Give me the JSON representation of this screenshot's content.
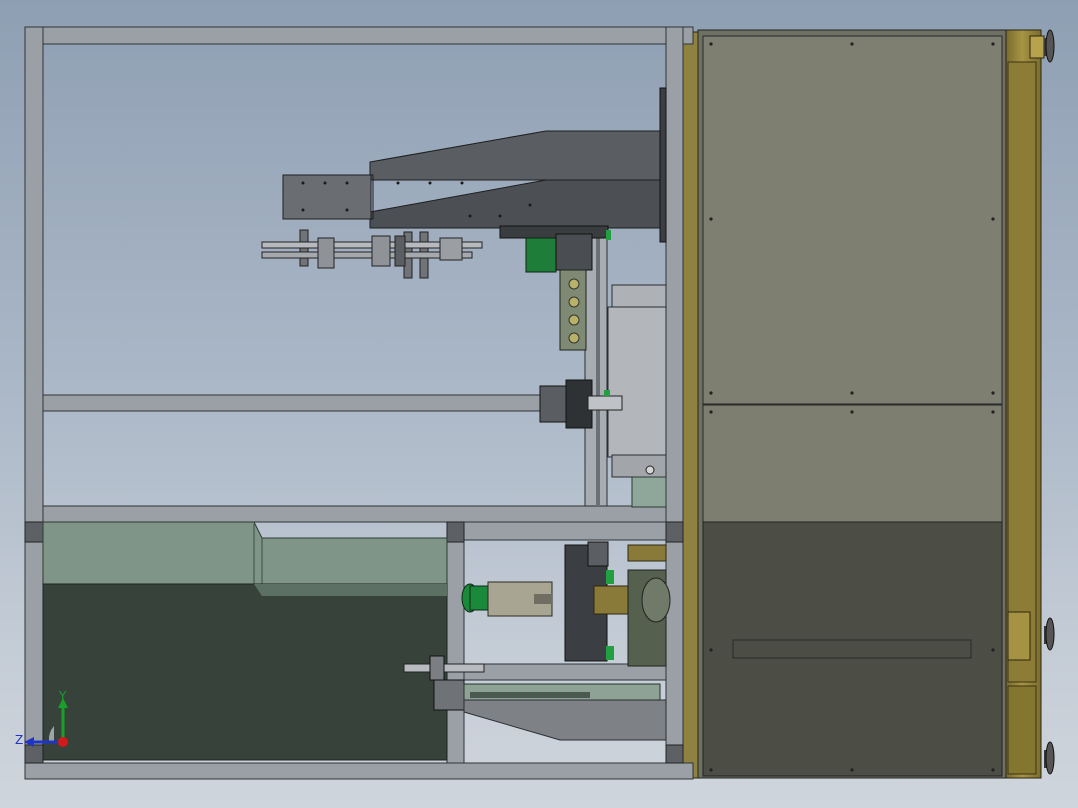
{
  "viewport": {
    "colors": {
      "frame": "#9aa0a6",
      "panel": "#7f8173",
      "panel_lower": "#4d5047",
      "guard_green": "#7e9589",
      "guard_dark": "#36423b",
      "base_gold": "#8a7a3a",
      "dark_steel": "#4b4e52",
      "accent_green": "#1a8a3a"
    }
  },
  "triad": {
    "y_label": "Y",
    "z_label": "Z",
    "y_color": "#18a02a",
    "z_color": "#1f35c8",
    "origin_color": "#d21a1a"
  }
}
